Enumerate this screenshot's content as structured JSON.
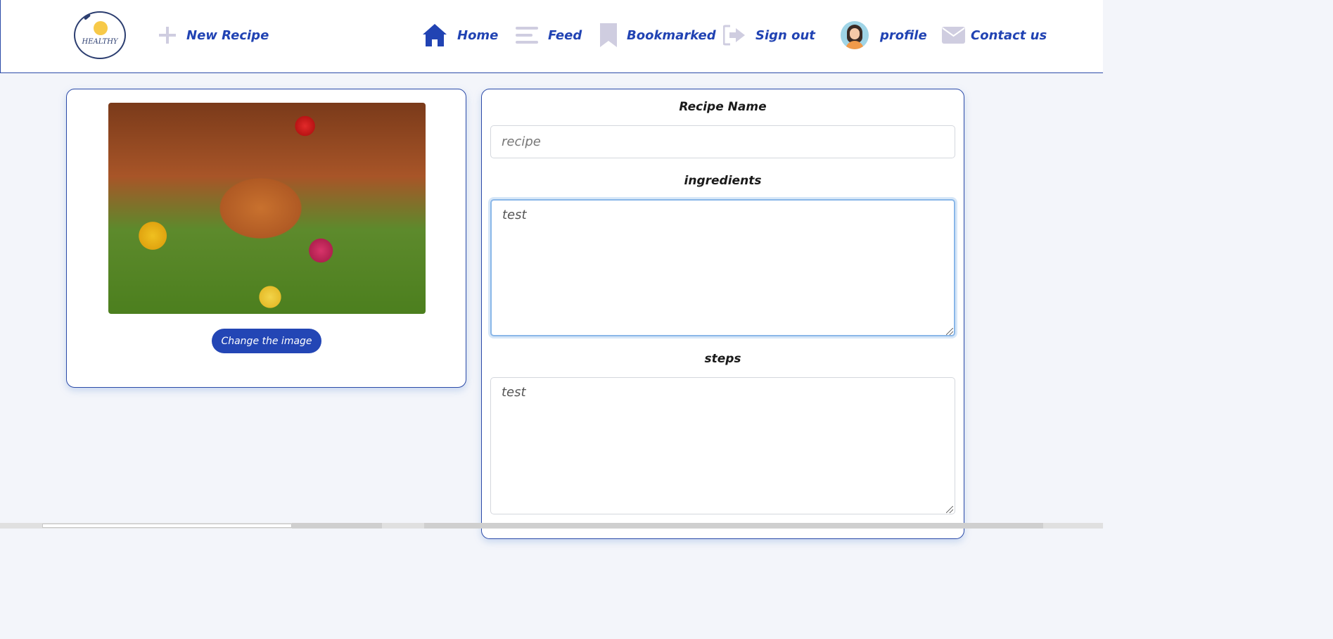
{
  "nav": {
    "logo_text": "HEALTHY",
    "new_recipe": "New Recipe",
    "home": "Home",
    "feed": "Feed",
    "bookmarked": "Bookmarked",
    "sign_out": "Sign out",
    "profile": "profile",
    "contact": "Contact us",
    "colors": {
      "link": "#2143b3",
      "muted_icon": "#cfcde0",
      "active_icon": "#2143b3"
    }
  },
  "image_panel": {
    "image_description": "roast-chicken-with-vegetables",
    "change_button": "Change the image"
  },
  "form": {
    "recipe_name_label": "Recipe Name",
    "recipe_name_value": "",
    "recipe_name_placeholder": "recipe",
    "ingredients_label": "ingredients",
    "ingredients_value": "test",
    "steps_label": "steps",
    "steps_value": "test"
  },
  "colors": {
    "background": "#f3f5fa",
    "card_border": "#2b4aa8",
    "button_bg": "#2346b5",
    "focus_ring": "#8ab7e8"
  }
}
